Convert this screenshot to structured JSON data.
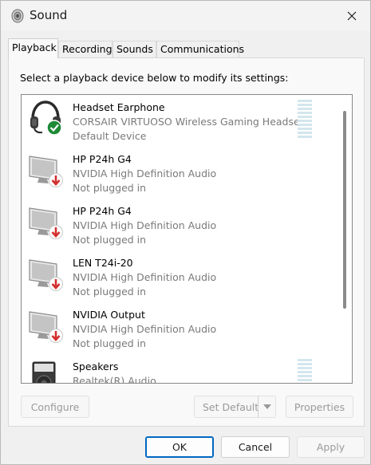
{
  "window": {
    "title": "Sound"
  },
  "tabs": [
    {
      "label": "Playback",
      "active": true
    },
    {
      "label": "Recording",
      "active": false
    },
    {
      "label": "Sounds",
      "active": false
    },
    {
      "label": "Communications",
      "active": false
    }
  ],
  "playback": {
    "instructions": "Select a playback device below to modify its settings:",
    "devices": [
      {
        "name": "Headset Earphone",
        "driver": "CORSAIR VIRTUOSO Wireless Gaming Headset",
        "status": "Default Device",
        "icon": "headset-icon",
        "badge": "check-icon"
      },
      {
        "name": "HP P24h G4",
        "driver": "NVIDIA High Definition Audio",
        "status": "Not plugged in",
        "icon": "monitor-icon",
        "badge": "down-arrow-icon"
      },
      {
        "name": "HP P24h G4",
        "driver": "NVIDIA High Definition Audio",
        "status": "Not plugged in",
        "icon": "monitor-icon",
        "badge": "down-arrow-icon"
      },
      {
        "name": "LEN T24i-20",
        "driver": "NVIDIA High Definition Audio",
        "status": "Not plugged in",
        "icon": "monitor-icon",
        "badge": "down-arrow-icon"
      },
      {
        "name": "NVIDIA Output",
        "driver": "NVIDIA High Definition Audio",
        "status": "Not plugged in",
        "icon": "monitor-icon",
        "badge": "down-arrow-icon"
      },
      {
        "name": "Speakers",
        "driver": "Realtek(R) Audio",
        "status": "",
        "icon": "speaker-icon",
        "badge": ""
      }
    ],
    "buttons": {
      "configure": "Configure",
      "set_default": "Set Default",
      "properties": "Properties"
    }
  },
  "footer": {
    "ok": "OK",
    "cancel": "Cancel",
    "apply": "Apply"
  },
  "colors": {
    "accent": "#0067c0",
    "default_check": "#1e8a36",
    "unplugged": "#d32f2f"
  }
}
